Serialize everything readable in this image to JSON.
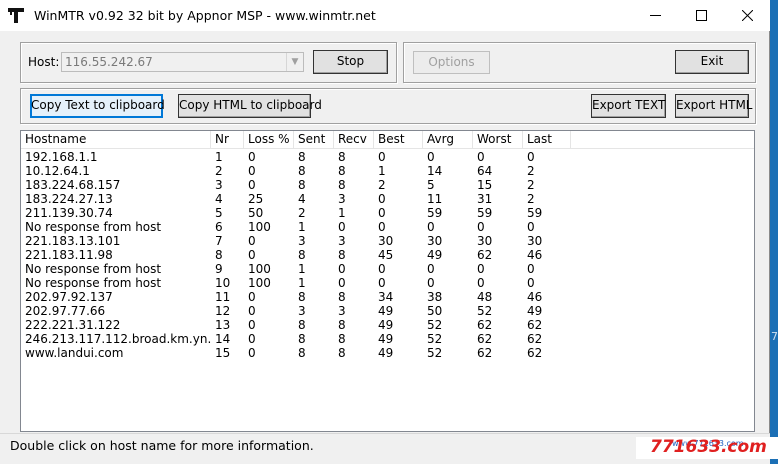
{
  "window": {
    "title": "WinMTR v0.92 32 bit by Appnor MSP - www.winmtr.net"
  },
  "host": {
    "label": "Host:",
    "value": "116.55.242.67"
  },
  "buttons": {
    "stop": "Stop",
    "options": "Options",
    "exit": "Exit",
    "copy_text": "Copy Text to clipboard",
    "copy_html": "Copy HTML to clipboard",
    "export_text": "Export TEXT",
    "export_html": "Export HTML"
  },
  "table": {
    "columns": [
      "Hostname",
      "Nr",
      "Loss %",
      "Sent",
      "Recv",
      "Best",
      "Avrg",
      "Worst",
      "Last"
    ],
    "rows": [
      [
        "192.168.1.1",
        "1",
        "0",
        "8",
        "8",
        "0",
        "0",
        "0",
        "0"
      ],
      [
        "10.12.64.1",
        "2",
        "0",
        "8",
        "8",
        "1",
        "14",
        "64",
        "2"
      ],
      [
        "183.224.68.157",
        "3",
        "0",
        "8",
        "8",
        "2",
        "5",
        "15",
        "2"
      ],
      [
        "183.224.27.13",
        "4",
        "25",
        "4",
        "3",
        "0",
        "11",
        "31",
        "2"
      ],
      [
        "211.139.30.74",
        "5",
        "50",
        "2",
        "1",
        "0",
        "59",
        "59",
        "59"
      ],
      [
        "No response from host",
        "6",
        "100",
        "1",
        "0",
        "0",
        "0",
        "0",
        "0"
      ],
      [
        "221.183.13.101",
        "7",
        "0",
        "3",
        "3",
        "30",
        "30",
        "30",
        "30"
      ],
      [
        "221.183.11.98",
        "8",
        "0",
        "8",
        "8",
        "45",
        "49",
        "62",
        "46"
      ],
      [
        "No response from host",
        "9",
        "100",
        "1",
        "0",
        "0",
        "0",
        "0",
        "0"
      ],
      [
        "No response from host",
        "10",
        "100",
        "1",
        "0",
        "0",
        "0",
        "0",
        "0"
      ],
      [
        "202.97.92.137",
        "11",
        "0",
        "8",
        "8",
        "34",
        "38",
        "48",
        "46"
      ],
      [
        "202.97.77.66",
        "12",
        "0",
        "3",
        "3",
        "49",
        "50",
        "52",
        "49"
      ],
      [
        "222.221.31.122",
        "13",
        "0",
        "8",
        "8",
        "49",
        "52",
        "62",
        "62"
      ],
      [
        "246.213.117.112.broad.km.yn.dyna...",
        "14",
        "0",
        "8",
        "8",
        "49",
        "52",
        "62",
        "62"
      ],
      [
        "www.landui.com",
        "15",
        "0",
        "8",
        "8",
        "49",
        "52",
        "62",
        "62"
      ]
    ]
  },
  "status": {
    "text": "Double click on host name for more information."
  },
  "watermark": {
    "main": "771633.com",
    "sub": "www.771633.com"
  },
  "edge": {
    "digit": "7"
  }
}
